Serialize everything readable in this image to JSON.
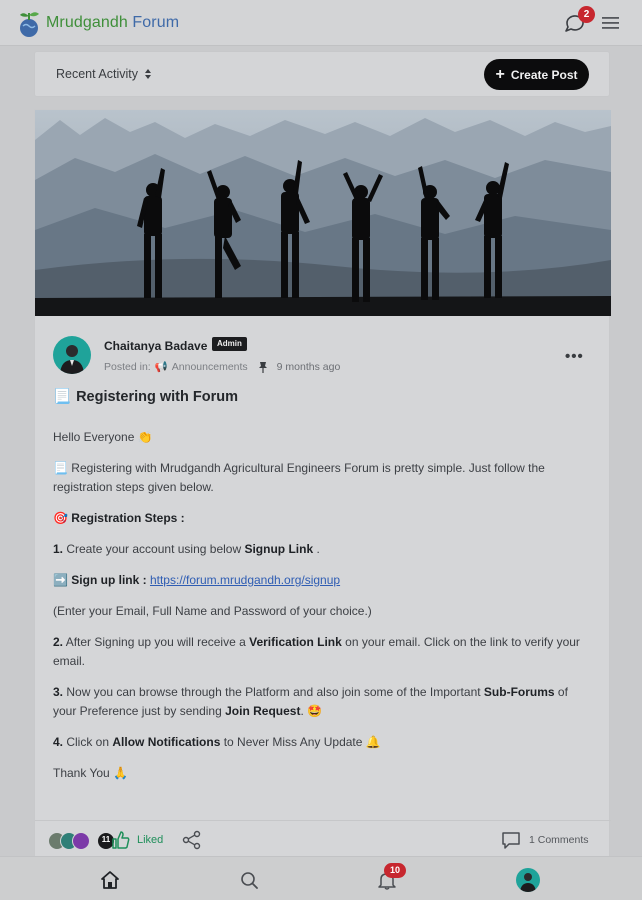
{
  "header": {
    "brand_part1": "Mrudgandh",
    "brand_part2": " Forum",
    "chat_badge": "2",
    "logo_icon": "globe-sprout-icon",
    "chat_icon": "chat-bubble-icon",
    "menu_icon": "hamburger-icon"
  },
  "toolbar": {
    "sort_label": "Recent Activity",
    "create_label": "Create Post"
  },
  "post": {
    "author": "Chaitanya Badave",
    "role_badge": "Admin",
    "posted_in_label": "Posted in:",
    "category": "Announcements",
    "time": "9 months ago",
    "more": "•••",
    "title": "Registering with Forum",
    "greeting": "Hello Everyone",
    "intro": "Registering with Mrudgandh Agricultural Engineers Forum is pretty simple. Just follow the registration steps given below.",
    "steps_heading": "Registration Steps :",
    "step1_num": "1.",
    "step1_pre": " Create your account using below ",
    "step1_bold": "Signup Link",
    "step1_post": " .",
    "signup_label": "Sign up link :",
    "signup_url": "https://forum.mrudgandh.org/signup",
    "enter_note": "(Enter your Email, Full Name and Password of your choice.)",
    "step2_num": "2.",
    "step2_pre": " After Signing up you will receive a ",
    "step2_bold": "Verification Link",
    "step2_post": " on your email. Click on the link to verify your email.",
    "step3_num": "3.",
    "step3_pre": " Now you can browse through the Platform and also join some of the Important ",
    "step3_bold1": "Sub-Forums",
    "step3_mid": " of your Preference just by sending ",
    "step3_bold2": "Join Request",
    "step3_post": ".",
    "step4_num": "4.",
    "step4_pre": " Click on ",
    "step4_bold": "Allow Notifications",
    "step4_post": " to Never Miss Any Update",
    "thanks": "Thank You"
  },
  "actions": {
    "likers_count": "11",
    "liked_label": "Liked",
    "comments_label": "1 Comments"
  },
  "nav": {
    "bell_badge": "10",
    "home_icon": "home-icon",
    "search_icon": "search-icon",
    "bell_icon": "bell-icon"
  },
  "colors": {
    "accent_green": "#1f8f5a",
    "badge_red": "#c7272f",
    "avatar_teal": "#1fa39a",
    "button_dark": "#0c0c0d"
  }
}
